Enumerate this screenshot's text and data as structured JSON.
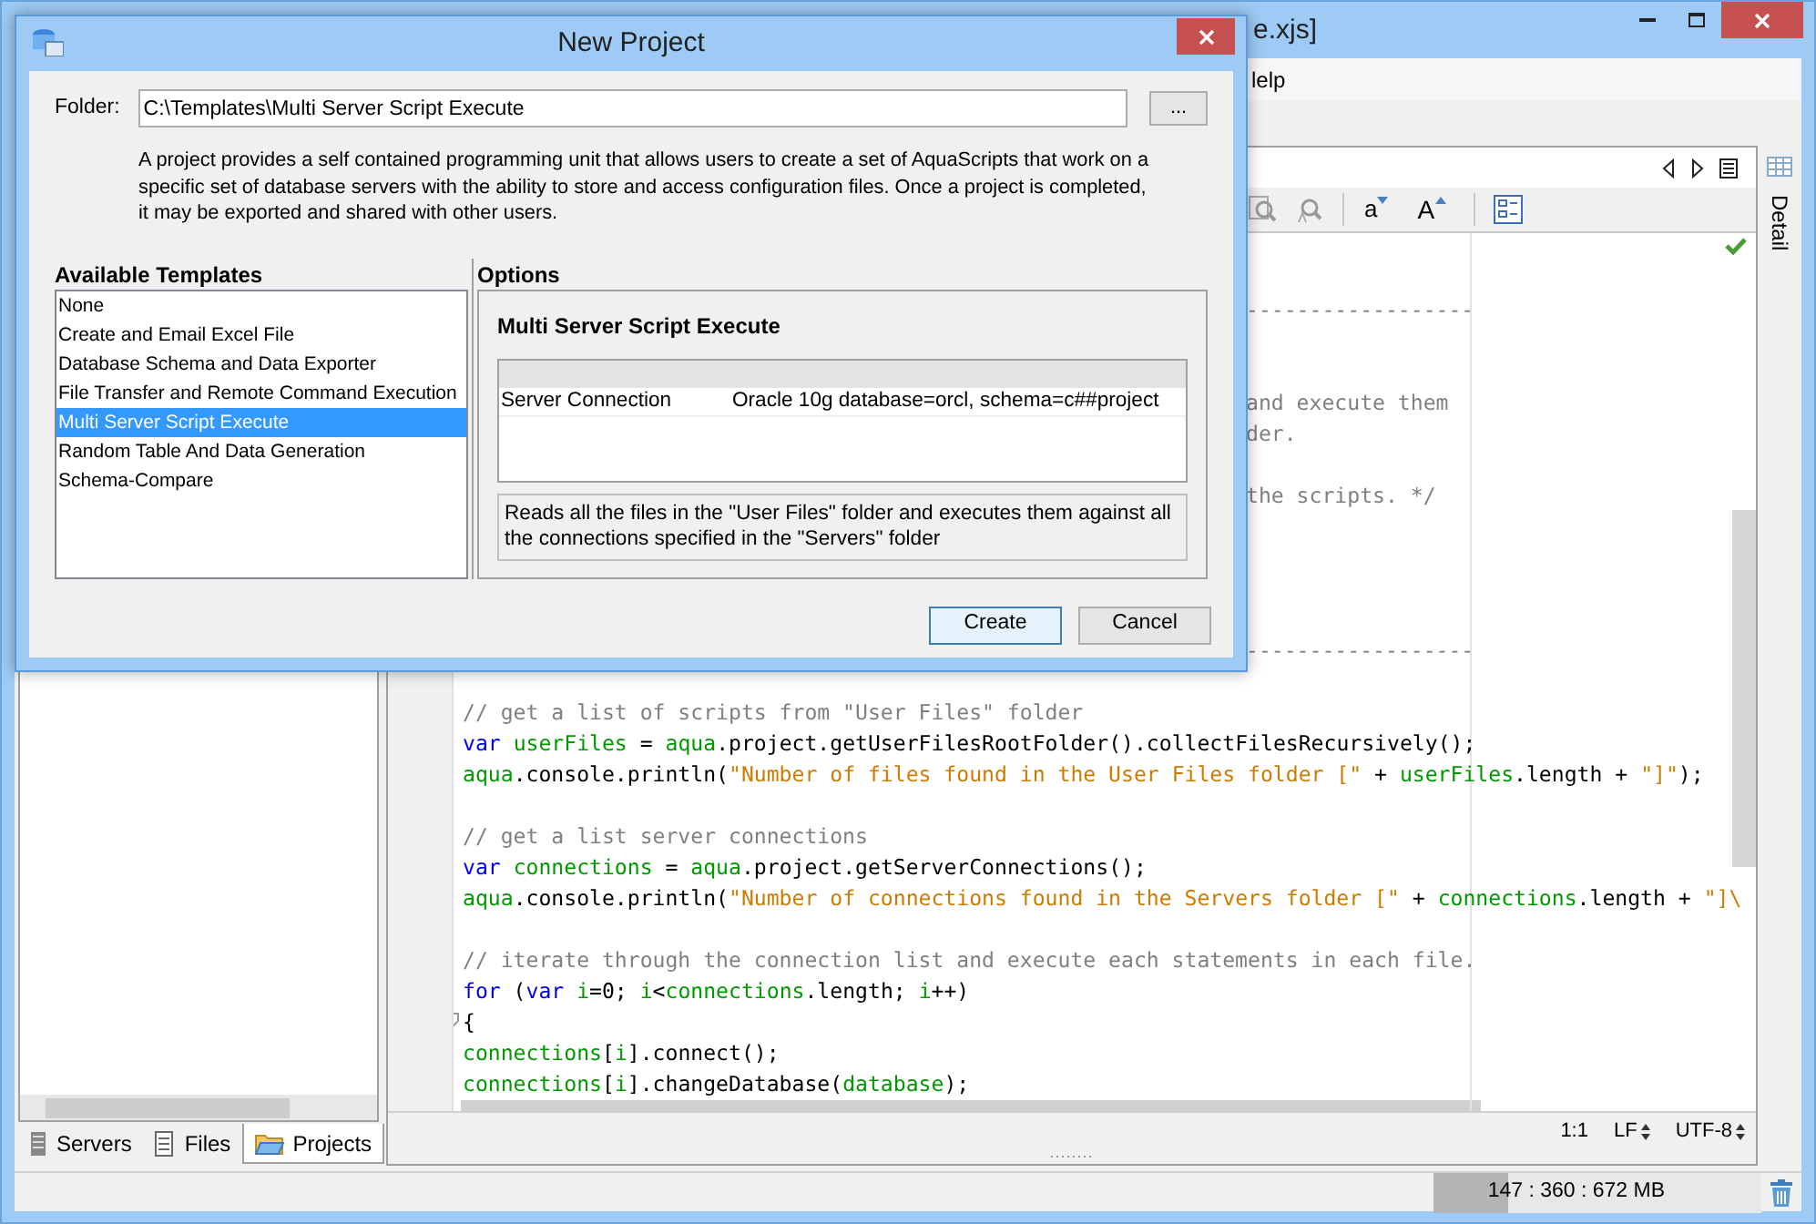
{
  "main_window": {
    "title": "e.xjs]",
    "menu": [
      "lelp"
    ]
  },
  "editor": {
    "font_buttons": [
      "a",
      "A"
    ],
    "lines": [
      {
        "kind": "blank"
      },
      {
        "kind": "blank"
      },
      {
        "kind": "partial",
        "text": "------------------"
      },
      {
        "kind": "blank"
      },
      {
        "kind": "blank"
      },
      {
        "kind": "partial",
        "text": "and execute them"
      },
      {
        "kind": "partial",
        "text": "der."
      },
      {
        "kind": "blank"
      },
      {
        "kind": "partial",
        "text": "the scripts. */"
      },
      {
        "kind": "blank"
      },
      {
        "kind": "blank"
      },
      {
        "kind": "blank"
      },
      {
        "kind": "blank"
      },
      {
        "kind": "partial",
        "text": "------------------"
      },
      {
        "kind": "blank"
      },
      {
        "kind": "code",
        "segments": [
          {
            "kind": "comment",
            "text": "// get a list of scripts from \"User Files\" folder"
          }
        ]
      },
      {
        "kind": "code",
        "segments": [
          {
            "kind": "keyword",
            "text": "var "
          },
          {
            "kind": "ident",
            "text": "userFiles"
          },
          {
            "kind": "plain",
            "text": " = "
          },
          {
            "kind": "ident",
            "text": "aqua"
          },
          {
            "kind": "plain",
            "text": ".project.getUserFilesRootFolder().collectFilesRecursively();"
          }
        ]
      },
      {
        "kind": "code",
        "segments": [
          {
            "kind": "ident",
            "text": "aqua"
          },
          {
            "kind": "plain",
            "text": ".console.println("
          },
          {
            "kind": "string",
            "text": "\"Number of files found in the User Files folder [\""
          },
          {
            "kind": "plain",
            "text": " + "
          },
          {
            "kind": "ident",
            "text": "userFiles"
          },
          {
            "kind": "plain",
            "text": ".length + "
          },
          {
            "kind": "string",
            "text": "\"]\""
          },
          {
            "kind": "plain",
            "text": ");"
          }
        ]
      },
      {
        "kind": "blank"
      },
      {
        "kind": "code",
        "segments": [
          {
            "kind": "comment",
            "text": "// get a list server connections"
          }
        ]
      },
      {
        "kind": "code",
        "segments": [
          {
            "kind": "keyword",
            "text": "var "
          },
          {
            "kind": "ident",
            "text": "connections"
          },
          {
            "kind": "plain",
            "text": " = "
          },
          {
            "kind": "ident",
            "text": "aqua"
          },
          {
            "kind": "plain",
            "text": ".project.getServerConnections();"
          }
        ]
      },
      {
        "kind": "code",
        "segments": [
          {
            "kind": "ident",
            "text": "aqua"
          },
          {
            "kind": "plain",
            "text": ".console.println("
          },
          {
            "kind": "string",
            "text": "\"Number of connections found in the Servers folder [\""
          },
          {
            "kind": "plain",
            "text": " + "
          },
          {
            "kind": "ident",
            "text": "connections"
          },
          {
            "kind": "plain",
            "text": ".length + "
          },
          {
            "kind": "string",
            "text": "\"]\\"
          }
        ]
      },
      {
        "kind": "blank"
      },
      {
        "kind": "code",
        "segments": [
          {
            "kind": "comment",
            "text": "// iterate through the connection list and execute each statements in each file."
          }
        ]
      },
      {
        "kind": "code",
        "segments": [
          {
            "kind": "keyword",
            "text": "for"
          },
          {
            "kind": "plain",
            "text": " ("
          },
          {
            "kind": "keyword",
            "text": "var "
          },
          {
            "kind": "ident",
            "text": "i"
          },
          {
            "kind": "plain",
            "text": "=0; "
          },
          {
            "kind": "ident",
            "text": "i"
          },
          {
            "kind": "plain",
            "text": "<"
          },
          {
            "kind": "ident",
            "text": "connections"
          },
          {
            "kind": "plain",
            "text": ".length; "
          },
          {
            "kind": "ident",
            "text": "i"
          },
          {
            "kind": "plain",
            "text": "++)"
          }
        ]
      },
      {
        "kind": "fold",
        "segments": [
          {
            "kind": "plain",
            "text": "{"
          }
        ]
      },
      {
        "kind": "code",
        "segments": [
          {
            "kind": "ident",
            "text": "connections"
          },
          {
            "kind": "plain",
            "text": "["
          },
          {
            "kind": "ident",
            "text": "i"
          },
          {
            "kind": "plain",
            "text": "].connect();"
          }
        ]
      },
      {
        "kind": "code",
        "segments": [
          {
            "kind": "ident",
            "text": "connections"
          },
          {
            "kind": "plain",
            "text": "["
          },
          {
            "kind": "ident",
            "text": "i"
          },
          {
            "kind": "plain",
            "text": "].changeDatabase("
          },
          {
            "kind": "ident",
            "text": "database"
          },
          {
            "kind": "plain",
            "text": ");"
          }
        ]
      }
    ],
    "status": {
      "position": "1:1",
      "line_ending": "LF",
      "encoding": "UTF-8"
    }
  },
  "side_panel": {
    "label": "Detail"
  },
  "left_tabs": [
    {
      "label": "Servers",
      "selected": false
    },
    {
      "label": "Files",
      "selected": false
    },
    {
      "label": "Projects",
      "selected": true
    }
  ],
  "memory": {
    "reading": "147 : 360 : 672 MB",
    "level": 0.23
  },
  "dialog": {
    "title": "New Project",
    "folder_label": "Folder:",
    "folder_value": "C:\\Templates\\Multi Server Script Execute",
    "browse_button": "...",
    "description": "A project provides a self contained programming unit that allows users to create a set of AquaScripts that work on a specific set of database servers with the ability to store and access configuration files.  Once a project is completed, it may be exported and shared with other users.",
    "templates_heading": "Available Templates",
    "templates": [
      {
        "label": "None",
        "selected": false
      },
      {
        "label": "Create and Email Excel File",
        "selected": false
      },
      {
        "label": "Database Schema and Data Exporter",
        "selected": false
      },
      {
        "label": "File Transfer and Remote Command Execution",
        "selected": false
      },
      {
        "label": "Multi Server Script Execute",
        "selected": true
      },
      {
        "label": "Random Table And Data Generation",
        "selected": false
      },
      {
        "label": "Schema-Compare",
        "selected": false
      }
    ],
    "options_heading": "Options",
    "options_title": "Multi Server Script Execute",
    "options_rows": [
      {
        "name": "Server Connection",
        "value": "Oracle 10g database=orcl, schema=c##project"
      }
    ],
    "options_description": "Reads all the files in the \"User Files\" folder and executes them against all the connections specified in the \"Servers\" folder",
    "buttons": [
      {
        "label": "Create",
        "default": true
      },
      {
        "label": "Cancel",
        "default": false
      }
    ]
  }
}
